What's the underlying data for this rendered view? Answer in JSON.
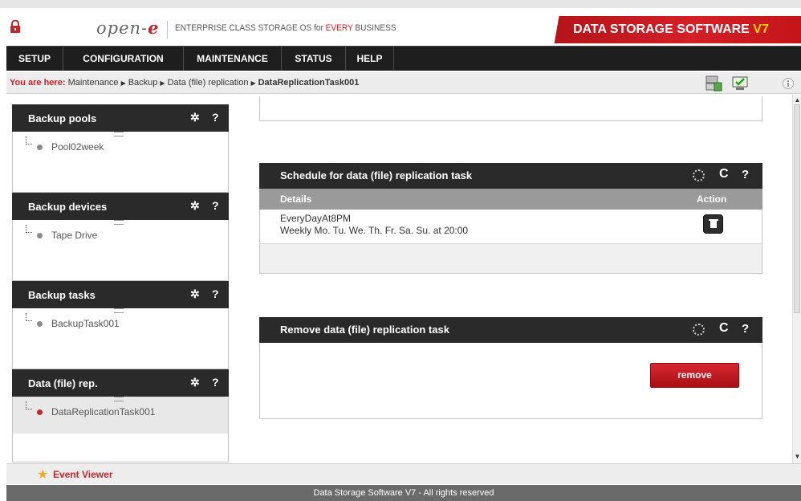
{
  "header": {
    "logo_main": "open-",
    "logo_e": "e",
    "tagline_pre": "ENTERPRISE CLASS STORAGE OS for ",
    "tagline_em": "EVERY",
    "tagline_post": " BUSINESS",
    "brand_text": "DATA STORAGE SOFTWARE ",
    "brand_version": "V7"
  },
  "nav": {
    "items": [
      "SETUP",
      "CONFIGURATION",
      "MAINTENANCE",
      "STATUS",
      "HELP"
    ]
  },
  "breadcrumb": {
    "prefix": "You are here:",
    "items": [
      "Maintenance",
      "Backup",
      "Data (file) replication"
    ],
    "current": "DataReplicationTask001"
  },
  "sidebar": {
    "boxes": [
      {
        "title": "Backup pools",
        "item": "Pool02week",
        "selected": false
      },
      {
        "title": "Backup devices",
        "item": "Tape Drive",
        "selected": false
      },
      {
        "title": "Backup tasks",
        "item": "BackupTask001",
        "selected": false
      },
      {
        "title": "Data (file) rep.",
        "item": "DataReplicationTask001",
        "selected": true
      }
    ],
    "gear_glyph": "✲",
    "help_glyph": "?"
  },
  "schedule_panel": {
    "title": "Schedule for data (file) replication task",
    "col_details": "Details",
    "col_action": "Action",
    "row_name": "EveryDayAt8PM",
    "row_desc": "Weekly Mo. Tu. We. Th. Fr. Sa. Su. at 20:00"
  },
  "remove_panel": {
    "title": "Remove data (file) replication task",
    "button": "remove"
  },
  "panel_icons": {
    "refresh": "C",
    "help": "?"
  },
  "eventbar": {
    "label": "Event Viewer"
  },
  "footer": {
    "text": "Data Storage Software V7 - All rights reserved"
  },
  "colors": {
    "accent": "#c1272d",
    "dark": "#2a2a2a"
  }
}
